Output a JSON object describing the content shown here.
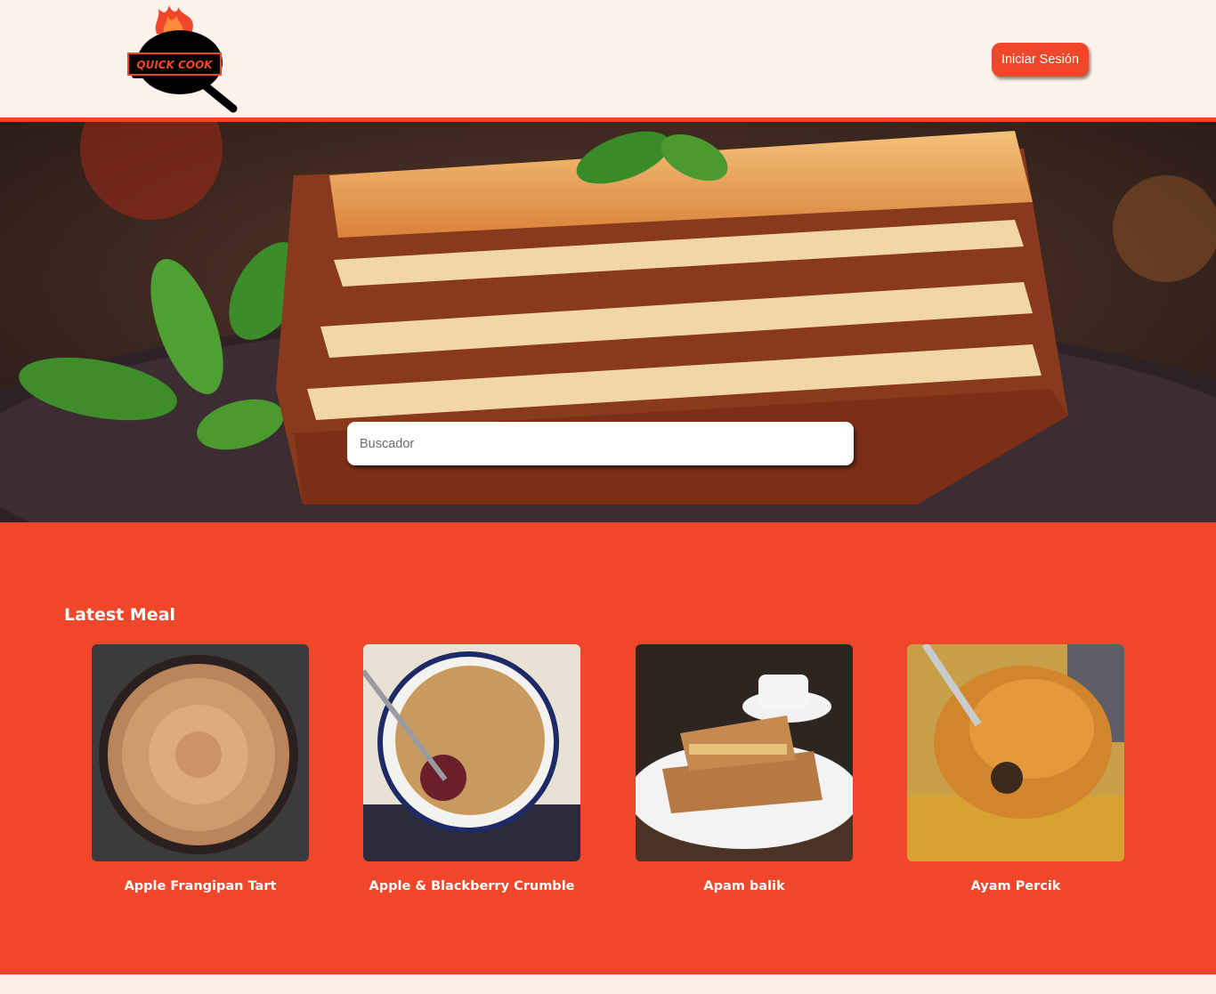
{
  "header": {
    "logo_text": "QUICK COOK",
    "login_label": "Iniciar Sesión"
  },
  "hero": {
    "search_placeholder": "Buscador"
  },
  "meals": {
    "title": "Latest Meal",
    "items": [
      {
        "name": "Apple Frangipan Tart",
        "image": "apple-frangipan-tart-photo"
      },
      {
        "name": "Apple & Blackberry Crumble",
        "image": "apple-blackberry-crumble-photo"
      },
      {
        "name": "Apam balik",
        "image": "apam-balik-photo"
      },
      {
        "name": "Ayam Percik",
        "image": "ayam-percik-photo"
      }
    ]
  },
  "colors": {
    "accent": "#f0462a",
    "background": "#fdf1ec"
  }
}
